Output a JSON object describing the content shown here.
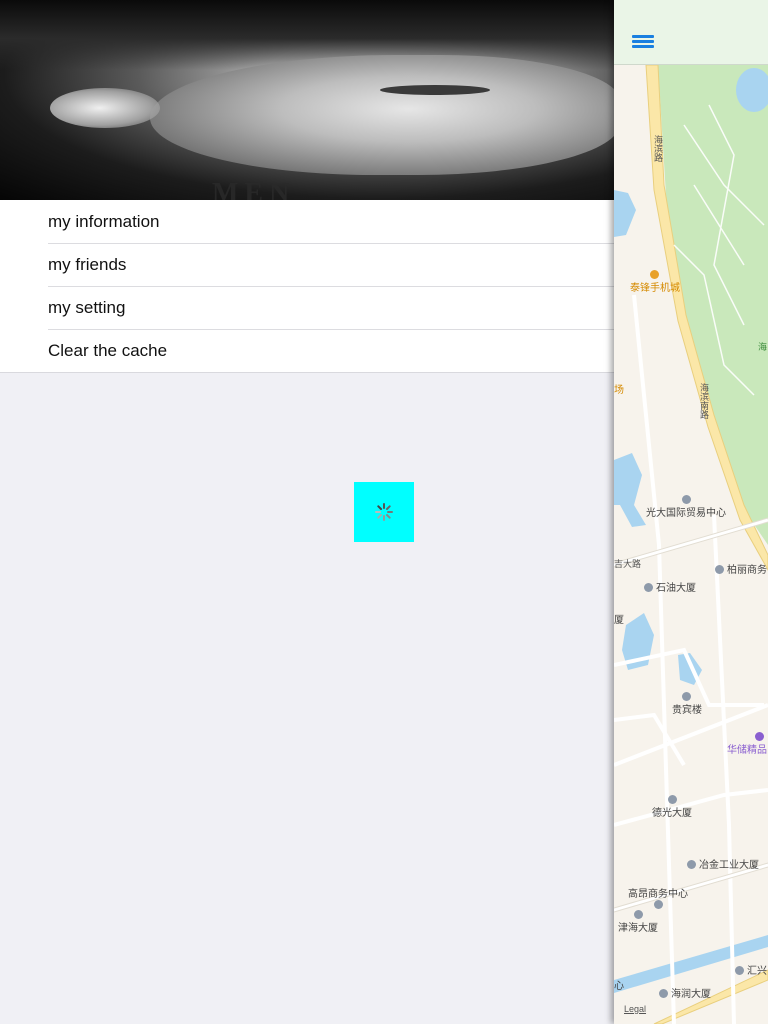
{
  "menu": {
    "header_logo": "MEN",
    "items": [
      {
        "label": "my information"
      },
      {
        "label": "my friends"
      },
      {
        "label": "my setting"
      },
      {
        "label": "Clear the cache"
      }
    ]
  },
  "colors": {
    "loader_bg": "#00ffff",
    "nav_icon": "#1a7fe0",
    "park": "#c9e8bb",
    "water": "#a9d4f0",
    "road": "#fbe7a8"
  },
  "map": {
    "road_labels": [
      "海滨路",
      "海滨南路",
      "吉大路",
      "海"
    ],
    "pois": [
      {
        "label": "泰锋手机城"
      },
      {
        "label": "场"
      },
      {
        "label": "光大国际贸易中心"
      },
      {
        "label": "柏丽商务"
      },
      {
        "label": "石油大厦"
      },
      {
        "label": "厦"
      },
      {
        "label": "贵宾楼"
      },
      {
        "label": "华储精品"
      },
      {
        "label": "德光大厦"
      },
      {
        "label": "冶金工业大厦"
      },
      {
        "label": "高昂商务中心"
      },
      {
        "label": "津海大厦"
      },
      {
        "label": "汇兴"
      },
      {
        "label": "海润大厦"
      },
      {
        "label": "心"
      }
    ],
    "legal": "Legal"
  },
  "icons": {
    "nav": "hamburger-menu-icon",
    "loader": "spinner-icon"
  }
}
